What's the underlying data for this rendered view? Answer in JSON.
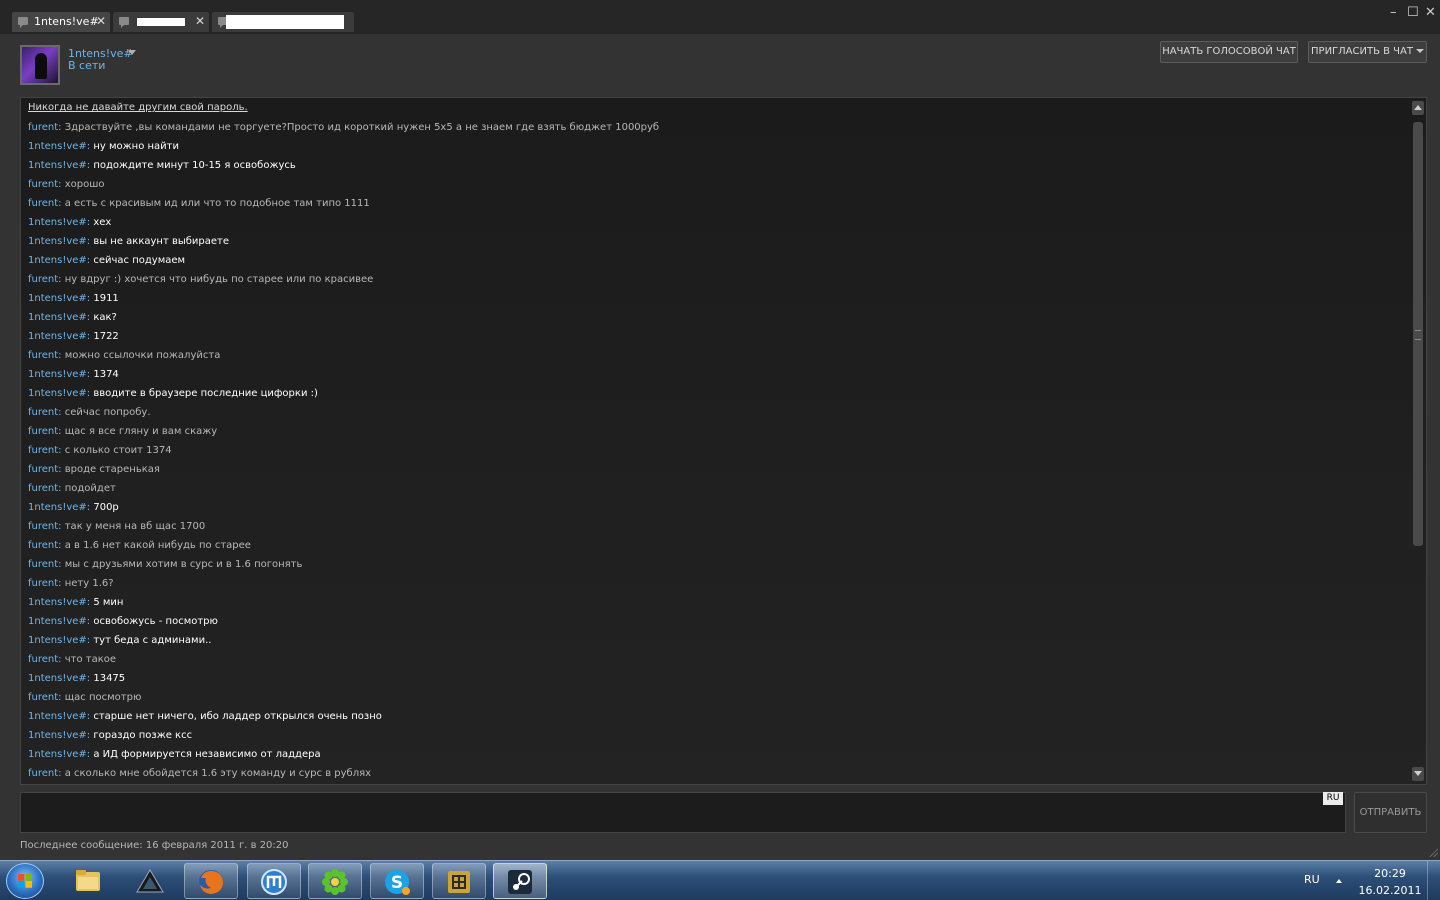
{
  "tabs": [
    {
      "label": "1ntens!ve#",
      "close": "✕",
      "active": true
    },
    {
      "label": "",
      "close": "✕",
      "active": false
    },
    {
      "label": "",
      "close": "",
      "active": false
    }
  ],
  "window_controls": {
    "minimize": "–",
    "maximize": "☐",
    "close": "✕"
  },
  "header": {
    "username": "1ntens!ve#",
    "status": "В сети",
    "voice_chat_button": "НАЧАТЬ ГОЛОСОВОЙ ЧАТ",
    "invite_button": "ПРИГЛАСИТЬ В ЧАТ"
  },
  "chat": {
    "warning": "Никогда не давайте другим свой пароль.",
    "messages": [
      {
        "sender": "furent",
        "text": "Здраствуйте ,вы командами не торгуете?Просто ид короткий нужен 5х5 а не знаем где взять бюджет 1000руб",
        "me": false
      },
      {
        "sender": "1ntens!ve#",
        "text": "ну можно найти",
        "me": true
      },
      {
        "sender": "1ntens!ve#",
        "text": "подождите минут 10-15 я освобожусь",
        "me": true
      },
      {
        "sender": "furent",
        "text": "хорошо",
        "me": false
      },
      {
        "sender": "furent",
        "text": "а есть с красивым ид или что то подобное там типо 1111",
        "me": false
      },
      {
        "sender": "1ntens!ve#",
        "text": "хех",
        "me": true
      },
      {
        "sender": "1ntens!ve#",
        "text": "вы не аккаунт выбираете",
        "me": true
      },
      {
        "sender": "1ntens!ve#",
        "text": "сейчас подумаем",
        "me": true
      },
      {
        "sender": "furent",
        "text": "ну вдруг :) хочется что нибудь по старее или по красивее",
        "me": false
      },
      {
        "sender": "1ntens!ve#",
        "text": "1911",
        "me": true
      },
      {
        "sender": "1ntens!ve#",
        "text": "как?",
        "me": true
      },
      {
        "sender": "1ntens!ve#",
        "text": "1722",
        "me": true
      },
      {
        "sender": "furent",
        "text": "можно ссылочки пожалуйста",
        "me": false
      },
      {
        "sender": "1ntens!ve#",
        "text": "1374",
        "me": true
      },
      {
        "sender": "1ntens!ve#",
        "text": "вводите в браузере последние цифорки :)",
        "me": true
      },
      {
        "sender": "furent",
        "text": "сейчас попробу.",
        "me": false
      },
      {
        "sender": "furent",
        "text": "щас я все гляну и вам скажу",
        "me": false
      },
      {
        "sender": "furent",
        "text": "с колько стоит 1374",
        "me": false
      },
      {
        "sender": "furent",
        "text": "вроде старенькая",
        "me": false
      },
      {
        "sender": "furent",
        "text": "подойдет",
        "me": false
      },
      {
        "sender": "1ntens!ve#",
        "text": "700р",
        "me": true
      },
      {
        "sender": "furent",
        "text": "так у меня на вб щас 1700",
        "me": false
      },
      {
        "sender": "furent",
        "text": "а в 1.6 нет какой нибудь по старее",
        "me": false
      },
      {
        "sender": "furent",
        "text": "мы с друзьями хотим в сурс и в 1.6 погонять",
        "me": false
      },
      {
        "sender": "furent",
        "text": "нету 1.6?",
        "me": false
      },
      {
        "sender": "1ntens!ve#",
        "text": "5 мин",
        "me": true
      },
      {
        "sender": "1ntens!ve#",
        "text": "освобожусь - посмотрю",
        "me": true
      },
      {
        "sender": "1ntens!ve#",
        "text": "тут беда с админами..",
        "me": true
      },
      {
        "sender": "furent",
        "text": "что такое",
        "me": false
      },
      {
        "sender": "1ntens!ve#",
        "text": "13475",
        "me": true
      },
      {
        "sender": "furent",
        "text": "щас посмотрю",
        "me": false
      },
      {
        "sender": "1ntens!ve#",
        "text": "старше нет ничего, ибо ладдер открылся очень позно",
        "me": true
      },
      {
        "sender": "1ntens!ve#",
        "text": "гораздо позже ксс",
        "me": true
      },
      {
        "sender": "1ntens!ve#",
        "text": "а ИД формируется независимо от ладдера",
        "me": true
      },
      {
        "sender": "furent",
        "text": "а сколько мне обойдется 1.6 эту команду и сурс в рублях",
        "me": false
      }
    ]
  },
  "input": {
    "lang": "RU",
    "send_button": "ОТПРАВИТЬ",
    "value": ""
  },
  "footer": {
    "last_message": "Последнее сообщение: 16 февраля 2011 г. в 20:20"
  },
  "taskbar": {
    "apps": [
      {
        "name": "explorer-icon",
        "pinned": true
      },
      {
        "name": "aimp-icon",
        "pinned": false
      },
      {
        "name": "firefox-icon",
        "pinned": true
      },
      {
        "name": "maxthon-icon",
        "pinned": true
      },
      {
        "name": "icq-icon",
        "pinned": true
      },
      {
        "name": "skype-icon",
        "pinned": true
      },
      {
        "name": "game-icon",
        "pinned": true
      },
      {
        "name": "steam-icon",
        "pinned": true
      }
    ],
    "lang": "RU",
    "time": "20:29",
    "date": "16.02.2011"
  },
  "colors": {
    "accent_name": "#6fb4e8",
    "background": "#333333",
    "chat_bg": "#1e1e1e"
  }
}
